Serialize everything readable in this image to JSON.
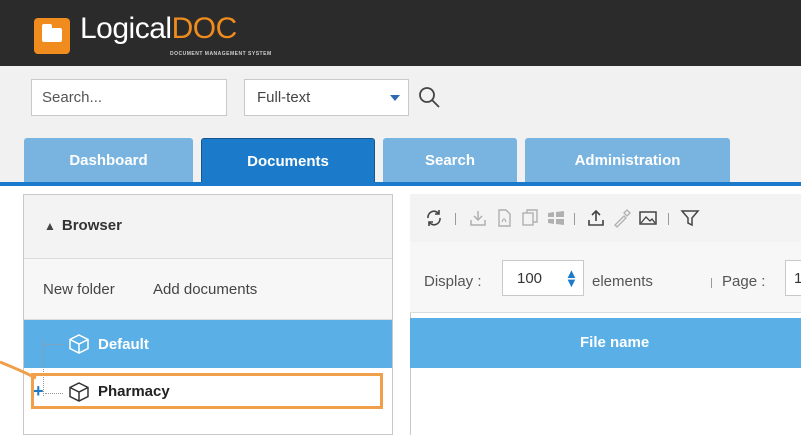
{
  "app": {
    "logo_part1": "Logical",
    "logo_part2": "DOC",
    "logo_subtitle": "DOCUMENT MANAGEMENT SYSTEM",
    "brand_color": "#f08c1e"
  },
  "search": {
    "placeholder": "Search...",
    "mode_selected": "Full-text",
    "submit_icon": "search-icon"
  },
  "tabs": [
    {
      "label": "Dashboard",
      "active": false
    },
    {
      "label": "Documents",
      "active": true
    },
    {
      "label": "Search",
      "active": false
    },
    {
      "label": "Administration",
      "active": false
    }
  ],
  "browser": {
    "title": "Browser",
    "actions": [
      "New folder",
      "Add documents"
    ],
    "tree": [
      {
        "label": "Default",
        "selected": true
      },
      {
        "label": "Pharmacy",
        "selected": false,
        "highlighted": true
      }
    ]
  },
  "documents": {
    "toolbar_icons": [
      "refresh-icon",
      "download-icon",
      "pdf-icon",
      "copy-icon",
      "office-icon",
      "upload-icon",
      "dropper-icon",
      "image-icon",
      "filter-icon"
    ],
    "pager": {
      "display_label": "Display :",
      "display_value": "100",
      "elements_label": "elements",
      "page_label": "Page :",
      "page_value": "1"
    },
    "column_header": "File name"
  },
  "colors": {
    "tab_active": "#1b7ac9",
    "tab_inactive": "#79b4e0",
    "selection": "#5ab0e6",
    "highlight_border": "#f0a04b"
  }
}
